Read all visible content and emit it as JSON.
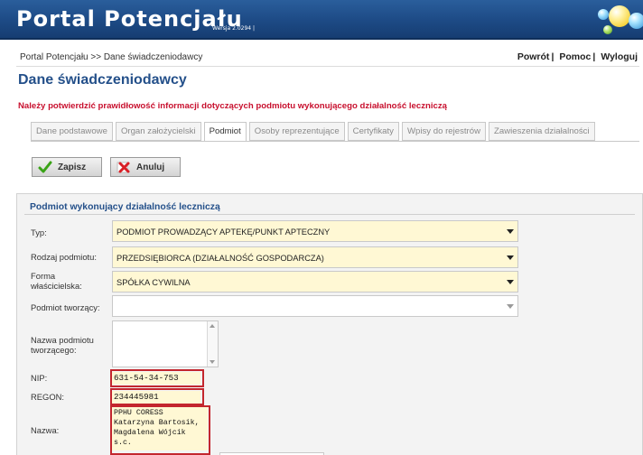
{
  "header": {
    "title": "Portal Potencjału",
    "version": "Wersja 2.0294 |"
  },
  "nav": {
    "breadcrumb": "Portal Potencjału >> Dane świadczeniodawcy",
    "links": [
      {
        "label": "Powrót",
        "sep": "|"
      },
      {
        "label": "Pomoc",
        "sep": "|"
      },
      {
        "label": "Wyloguj",
        "sep": ""
      }
    ]
  },
  "page": {
    "title": "Dane świadczeniodawcy",
    "notice": "Należy potwierdzić prawidłowość informacji dotyczących podmiotu wykonującego działalność leczniczą"
  },
  "tabs": [
    {
      "label": "Dane podstawowe",
      "active": false
    },
    {
      "label": "Organ założycielski",
      "active": false
    },
    {
      "label": "Podmiot",
      "active": true
    },
    {
      "label": "Osoby reprezentujące",
      "active": false
    },
    {
      "label": "Certyfikaty",
      "active": false
    },
    {
      "label": "Wpisy do rejestrów",
      "active": false
    },
    {
      "label": "Zawieszenia działalności",
      "active": false
    }
  ],
  "toolbar": {
    "save_label": "Zapisz",
    "cancel_label": "Anuluj"
  },
  "form": {
    "section_title": "Podmiot wykonujący działalność leczniczą",
    "typ": {
      "label": "Typ:",
      "value": "PODMIOT PROWADZĄCY APTEKĘ/PUNKT APTECZNY"
    },
    "rodzaj": {
      "label": "Rodzaj podmiotu:",
      "value": "PRZEDSIĘBIORCA (DZIAŁALNOŚĆ GOSPODARCZA)"
    },
    "forma": {
      "label": "Forma właścicielska:",
      "value": "SPÓŁKA CYWILNA"
    },
    "tworzacy": {
      "label": "Podmiot tworzący:",
      "value": ""
    },
    "nazwa_tworzacego": {
      "label": "Nazwa podmiotu tworzącego:",
      "value": ""
    },
    "nip": {
      "label": "NIP:",
      "value": "631-54-34-753"
    },
    "regon": {
      "label": "REGON:",
      "value": "234445981"
    },
    "nazwa": {
      "label": "Nazwa:",
      "lines": [
        "PPHU CORESS",
        "Katarzyna Bartosik,",
        "Magdalena Wójcik",
        "s.c."
      ]
    }
  },
  "colors": {
    "header_bg": "#1d4a85",
    "title_blue": "#24508a",
    "notice_red": "#c8102e",
    "field_yellow": "#fff8d4",
    "highlight_red": "#c3262e"
  }
}
